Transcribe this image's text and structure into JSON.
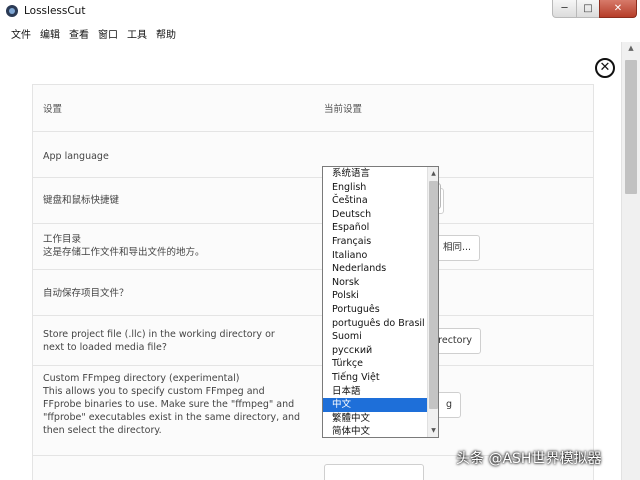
{
  "window": {
    "title": "LosslessCut",
    "controls": {
      "minimize": "─",
      "maximize": "□",
      "close": "✕"
    }
  },
  "menu": [
    "文件",
    "编辑",
    "查看",
    "窗口",
    "工具",
    "帮助"
  ],
  "settings": {
    "header": {
      "left": "设置",
      "right": "当前设置"
    },
    "rows": [
      {
        "label": "App language",
        "value": "中文"
      },
      {
        "label": "键盘和鼠标快捷键",
        "button": ""
      },
      {
        "label": "工作目录\n这是存储工作文件和导出文件的地方。",
        "button": "相同..."
      },
      {
        "label": "自动保存项目文件？",
        "button": ""
      },
      {
        "label": "Store project file (.llc) in the working directory or next to loaded media file?",
        "button": "rectory"
      },
      {
        "label": "Custom FFmpeg directory (experimental)\nThis allows you to specify custom FFmpeg and FFprobe binaries to use. Make sure the \"ffmpeg\" and \"ffprobe\" executables exist in the same directory, and then select the directory.",
        "button": "g"
      }
    ]
  },
  "language_dropdown": {
    "selected": "中文",
    "options": [
      "系统语言",
      "English",
      "Čeština",
      "Deutsch",
      "Español",
      "Français",
      "Italiano",
      "Nederlands",
      "Norsk",
      "Polski",
      "Português",
      "português do Brasil",
      "Suomi",
      "русский",
      "Türkçe",
      "Tiếng Việt",
      "日本語",
      "中文",
      "繁體中文",
      "简体中文"
    ]
  },
  "close_settings": "✕",
  "watermark": "头条 @ASH世界模拟器",
  "colors": {
    "selection": "#1e6fd9",
    "close_button": "#c24a36"
  },
  "icons": [
    "app-logo-icon",
    "close-circle-icon",
    "chevron-down-icon"
  ]
}
